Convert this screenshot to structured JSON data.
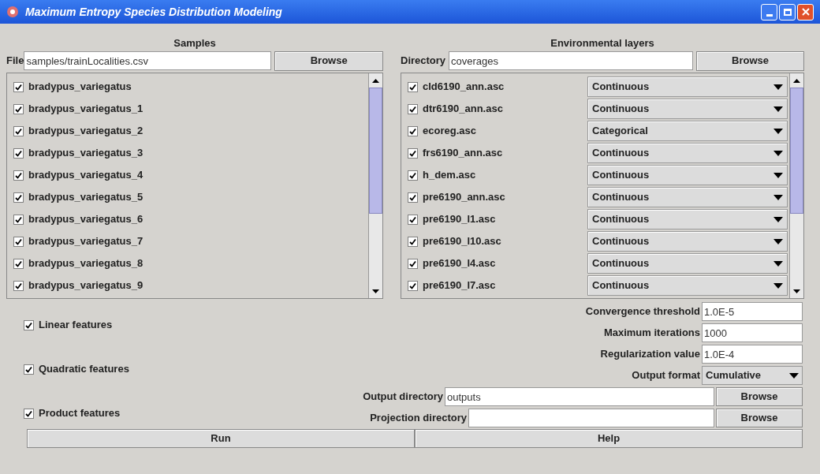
{
  "window": {
    "title": "Maximum Entropy Species Distribution Modeling"
  },
  "samples": {
    "heading": "Samples",
    "file_label": "File",
    "file_value": "samples/trainLocalities.csv",
    "browse": "Browse",
    "items": [
      {
        "label": "bradypus_variegatus",
        "checked": true
      },
      {
        "label": "bradypus_variegatus_1",
        "checked": true
      },
      {
        "label": "bradypus_variegatus_2",
        "checked": true
      },
      {
        "label": "bradypus_variegatus_3",
        "checked": true
      },
      {
        "label": "bradypus_variegatus_4",
        "checked": true
      },
      {
        "label": "bradypus_variegatus_5",
        "checked": true
      },
      {
        "label": "bradypus_variegatus_6",
        "checked": true
      },
      {
        "label": "bradypus_variegatus_7",
        "checked": true
      },
      {
        "label": "bradypus_variegatus_8",
        "checked": true
      },
      {
        "label": "bradypus_variegatus_9",
        "checked": true
      }
    ]
  },
  "layers": {
    "heading": "Environmental layers",
    "dir_label": "Directory",
    "dir_value": "coverages",
    "browse": "Browse",
    "items": [
      {
        "label": "cld6190_ann.asc",
        "checked": true,
        "type": "Continuous"
      },
      {
        "label": "dtr6190_ann.asc",
        "checked": true,
        "type": "Continuous"
      },
      {
        "label": "ecoreg.asc",
        "checked": true,
        "type": "Categorical"
      },
      {
        "label": "frs6190_ann.asc",
        "checked": true,
        "type": "Continuous"
      },
      {
        "label": "h_dem.asc",
        "checked": true,
        "type": "Continuous"
      },
      {
        "label": "pre6190_ann.asc",
        "checked": true,
        "type": "Continuous"
      },
      {
        "label": "pre6190_l1.asc",
        "checked": true,
        "type": "Continuous"
      },
      {
        "label": "pre6190_l10.asc",
        "checked": true,
        "type": "Continuous"
      },
      {
        "label": "pre6190_l4.asc",
        "checked": true,
        "type": "Continuous"
      },
      {
        "label": "pre6190_l7.asc",
        "checked": true,
        "type": "Continuous"
      }
    ]
  },
  "features": [
    {
      "label": "Linear features",
      "checked": true
    },
    {
      "label": "Quadratic features",
      "checked": true
    },
    {
      "label": "Product features",
      "checked": true
    }
  ],
  "settings": [
    {
      "label": "Convergence threshold",
      "value": "1.0E-5"
    },
    {
      "label": "Maximum iterations",
      "value": "1000"
    },
    {
      "label": "Regularization value",
      "value": "1.0E-4"
    }
  ],
  "output_format": {
    "label": "Output format",
    "value": "Cumulative"
  },
  "directories": [
    {
      "label": "Output directory",
      "value": "outputs",
      "browse": "Browse"
    },
    {
      "label": "Projection directory",
      "browse": "Browse"
    }
  ],
  "buttons": [
    "Run",
    "Help"
  ]
}
